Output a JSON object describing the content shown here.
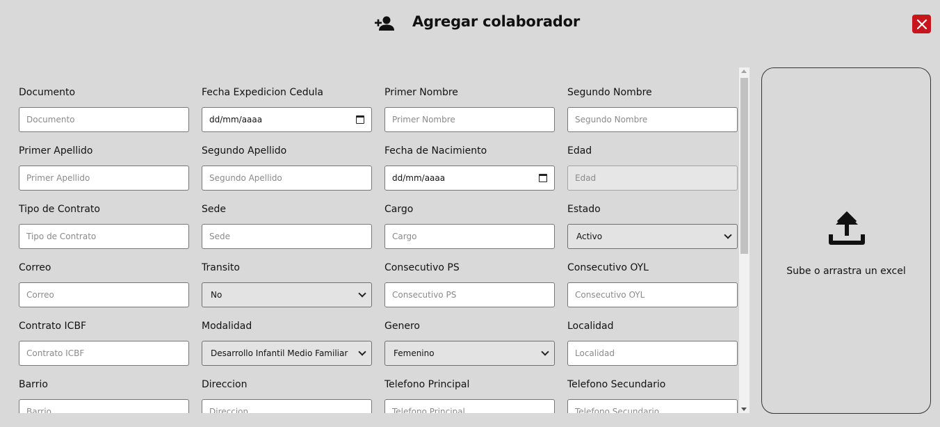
{
  "header": {
    "title": "Agregar colaborador",
    "icon": "person-add-icon",
    "close_icon": "close-icon"
  },
  "colors": {
    "background": "#d9d9d9",
    "close_button": "#c8141c"
  },
  "fields": [
    {
      "label": "Documento",
      "placeholder": "Documento",
      "type": "text"
    },
    {
      "label": "Fecha Expedicion Cedula",
      "value": "dd/mm/aaaa",
      "type": "date"
    },
    {
      "label": "Primer Nombre",
      "placeholder": "Primer Nombre",
      "type": "text"
    },
    {
      "label": "Segundo Nombre",
      "placeholder": "Segundo Nombre",
      "type": "text"
    },
    {
      "label": "Primer Apellido",
      "placeholder": "Primer Apellido",
      "type": "text"
    },
    {
      "label": "Segundo Apellido",
      "placeholder": "Segundo Apellido",
      "type": "text"
    },
    {
      "label": "Fecha de Nacimiento",
      "value": "dd/mm/aaaa",
      "type": "date"
    },
    {
      "label": "Edad",
      "placeholder": "Edad",
      "type": "disabled"
    },
    {
      "label": "Tipo de Contrato",
      "placeholder": "Tipo de Contrato",
      "type": "text"
    },
    {
      "label": "Sede",
      "placeholder": "Sede",
      "type": "text"
    },
    {
      "label": "Cargo",
      "placeholder": "Cargo",
      "type": "text"
    },
    {
      "label": "Estado",
      "value": "Activo",
      "type": "select"
    },
    {
      "label": "Correo",
      "placeholder": "Correo",
      "type": "text"
    },
    {
      "label": "Transito",
      "value": "No",
      "type": "select"
    },
    {
      "label": "Consecutivo PS",
      "placeholder": "Consecutivo PS",
      "type": "text"
    },
    {
      "label": "Consecutivo OYL",
      "placeholder": "Consecutivo OYL",
      "type": "text"
    },
    {
      "label": "Contrato ICBF",
      "placeholder": "Contrato ICBF",
      "type": "text"
    },
    {
      "label": "Modalidad",
      "value": "Desarrollo Infantil Medio Familiar",
      "type": "select"
    },
    {
      "label": "Genero",
      "value": "Femenino",
      "type": "select"
    },
    {
      "label": "Localidad",
      "placeholder": "Localidad",
      "type": "text"
    },
    {
      "label": "Barrio",
      "placeholder": "Barrio",
      "type": "text"
    },
    {
      "label": "Direccion",
      "placeholder": "Direccion",
      "type": "text"
    },
    {
      "label": "Telefono Principal",
      "placeholder": "Telefono Principal",
      "type": "text"
    },
    {
      "label": "Telefono Secundario",
      "placeholder": "Telefono Secundario",
      "type": "text"
    }
  ],
  "upload": {
    "label": "Sube o arrastra un excel",
    "icon": "upload-icon"
  }
}
